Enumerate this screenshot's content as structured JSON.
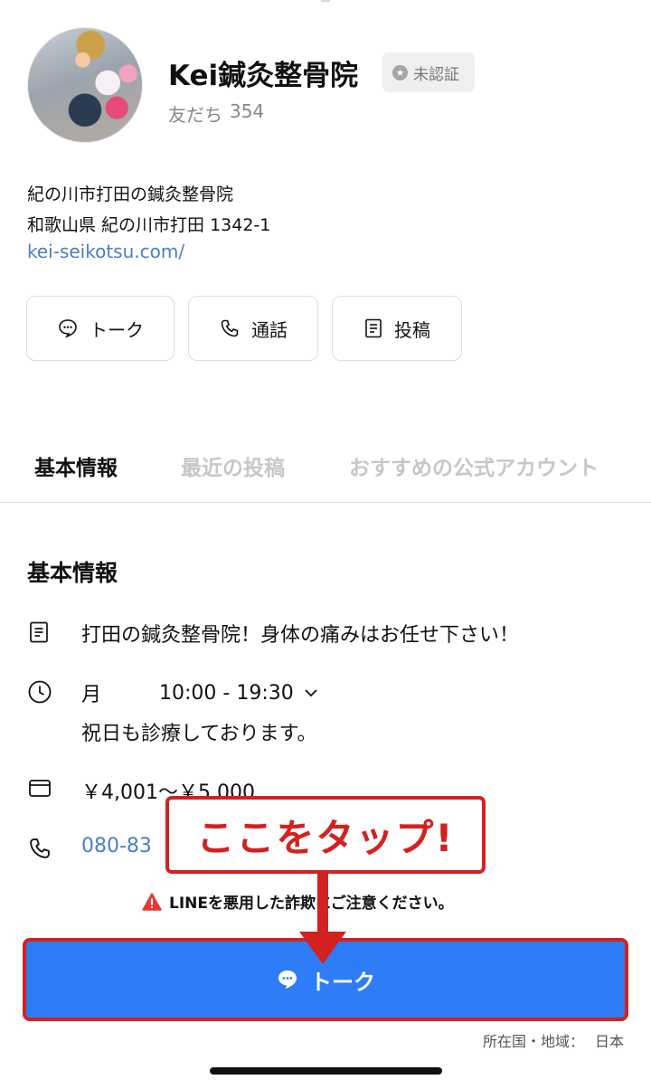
{
  "profile": {
    "name": "Kei鍼灸整骨院",
    "badge": "未認証",
    "friends_label": "友だち",
    "friends_count": "354",
    "description": "紀の川市打田の鍼灸整骨院",
    "address": "和歌山県 紀の川市打田 1342-1",
    "website": "kei-seikotsu.com/"
  },
  "actions": {
    "talk": "トーク",
    "call": "通話",
    "posts": "投稿"
  },
  "tabs": [
    "基本情報",
    "最近の投稿",
    "おすすめの公式アカウント"
  ],
  "info": {
    "title": "基本情報",
    "catchphrase": "打田の鍼灸整骨院！身体の痛みはお任せ下さい！",
    "hours_day": "月",
    "hours_time": "10:00 - 19:30",
    "hours_note": "祝日も診療しております。",
    "price": "￥4,001～￥5,000",
    "phone_partial": "080-83"
  },
  "warning": "LINEを悪用した詐欺にご注意ください。",
  "talk_button": "トーク",
  "region": {
    "label": "所在国・地域：",
    "value": "日本"
  },
  "annotation": {
    "callout": "ここをタップ!"
  },
  "colors": {
    "accent_blue": "#2e7df6",
    "link_blue": "#4a7fc8",
    "annotation_red": "#d32121"
  }
}
